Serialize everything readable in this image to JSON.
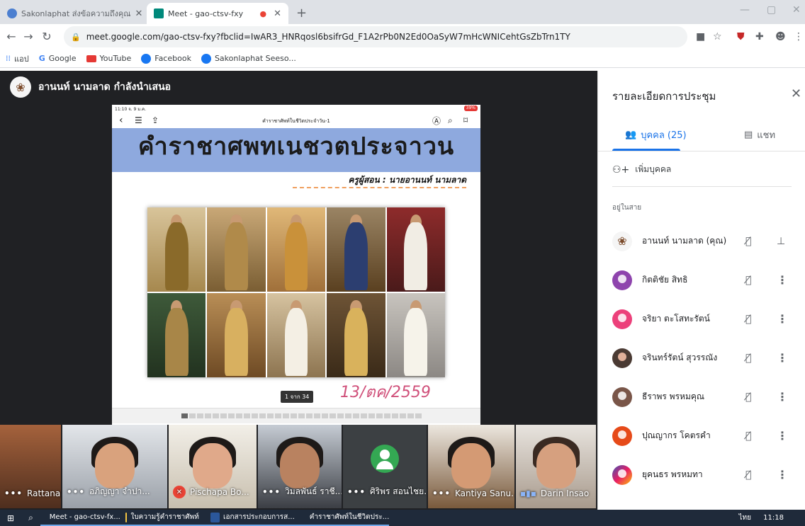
{
  "browser": {
    "tabs": [
      {
        "title": "Sakonlaphat ส่งข้อความถึงคุณ",
        "active": false
      },
      {
        "title": "Meet - gao-ctsv-fxy",
        "active": true
      }
    ],
    "new_tab": "+",
    "window_controls": [
      "—",
      "▢",
      "✕"
    ],
    "url": "meet.google.com/gao-ctsv-fxy?fbclid=IwAR3_HNRqosl6bsifrGd_F1A2rPb0N2Ed0OaSyW7mHcWNICehtGsZbTrn1TY",
    "bookmarks": [
      "แอป",
      "Google",
      "YouTube",
      "Facebook",
      "Sakonlaphat Seeso..."
    ]
  },
  "meeting": {
    "presenter_text": "อานนท์ นามลาด กำลังนำเสนอ",
    "slide": {
      "status_left": "11:10 จ. 9 ม.ค.",
      "battery": "39%",
      "doc_title": "คำราชาศัพท์ในชีวิตประจำวัน-1",
      "title": "คำราชาศพทเนชวตประจาวน",
      "teacher": "ครูผู้สอน :  นายอานนท์  นามลาด",
      "handwritten_date": "13/ตค/2559",
      "page_indicator": "1 จาก 34"
    },
    "participants": [
      {
        "name": "Rattanaporn ...",
        "state": "dots"
      },
      {
        "name": "อภิญญา จำปา...",
        "state": "dots"
      },
      {
        "name": "Pischapa Bo...",
        "state": "muted"
      },
      {
        "name": "วิมลพันธ์ ราชี...",
        "state": "dots"
      },
      {
        "name": "ศิริพร สอนไชย...",
        "state": "dots"
      },
      {
        "name": "Kantiya Sanu...",
        "state": "dots"
      },
      {
        "name": "Darin Insao",
        "state": "speaking"
      }
    ]
  },
  "panel": {
    "title": "รายละเอียดการประชุม",
    "tab_people": "บุคคล (25)",
    "tab_chat": "แชท",
    "add_people": "เพิ่มบุคคล",
    "section_label": "อยู่ในสาย",
    "people": [
      {
        "name": "อานนท์ นามลาด (คุณ)",
        "color": "#f5f5f5",
        "self": true
      },
      {
        "name": "กิตติชัย สิทธิ",
        "color": "#8e44ad",
        "self": false
      },
      {
        "name": "จริยา ตะโสทะรัตน์",
        "color": "#ec407a",
        "self": false
      },
      {
        "name": "จรินทร์รัตน์ สุวรรณัง",
        "color": "#4a3a33",
        "self": false
      },
      {
        "name": "ธีราพร พรหมคุณ",
        "color": "#795548",
        "self": false
      },
      {
        "name": "ปุณญากร โคตรคำ",
        "color": "#e64a19",
        "self": false
      },
      {
        "name": "ยุคนธร พรหมทา",
        "color": "#3f51b5",
        "self": false
      }
    ]
  },
  "taskbar": {
    "tasks": [
      "Meet - gao-ctsv-fx...",
      "ใบความรู้คำราชาศัพท์",
      "เอกสารประกอบการส...",
      "คำราชาศัพท์ในชีวิตประ..."
    ],
    "clock": "11:18",
    "lang": "ไทย"
  }
}
